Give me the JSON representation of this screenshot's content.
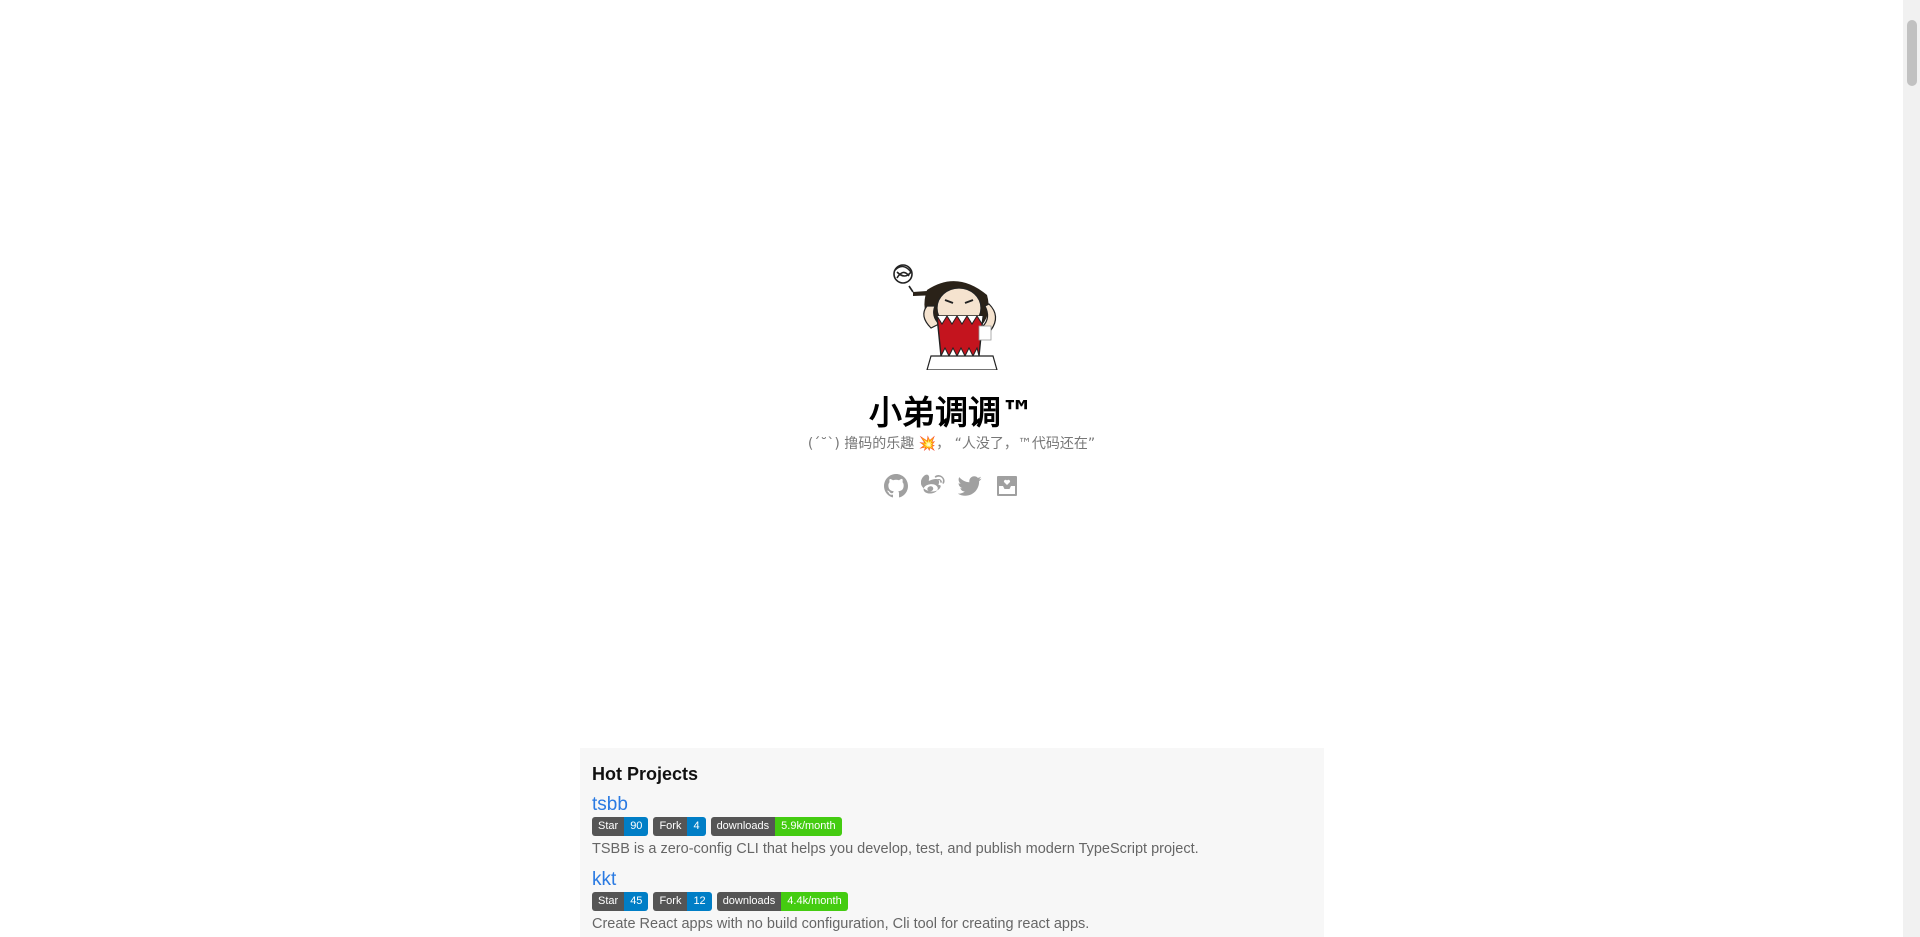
{
  "site": {
    "title": "小弟调调™",
    "tagline": "(ˊ˘ˋ) 撸码的乐趣 💥， “人没了，™代码还在”"
  },
  "social": [
    {
      "name": "github-icon"
    },
    {
      "name": "weibo-icon"
    },
    {
      "name": "twitter-icon"
    },
    {
      "name": "mail-icon"
    }
  ],
  "projects": {
    "title": "Hot Projects",
    "items": [
      {
        "name": "tsbb",
        "star_label": "Star",
        "star_value": "90",
        "fork_label": "Fork",
        "fork_value": "4",
        "downloads_label": "downloads",
        "downloads_value": "5.9k/month",
        "description": "TSBB is a zero-config CLI that helps you develop, test, and publish modern TypeScript project."
      },
      {
        "name": "kkt",
        "star_label": "Star",
        "star_value": "45",
        "fork_label": "Fork",
        "fork_value": "12",
        "downloads_label": "downloads",
        "downloads_value": "4.4k/month",
        "description": "Create React apps with no build configuration, Cli tool for creating react apps."
      }
    ]
  },
  "colors": {
    "link": "#2a7ae2",
    "badge_dark": "#555555",
    "badge_blue": "#007ec6",
    "badge_green": "#44cc11",
    "icon_gray": "#a0a0a0"
  }
}
